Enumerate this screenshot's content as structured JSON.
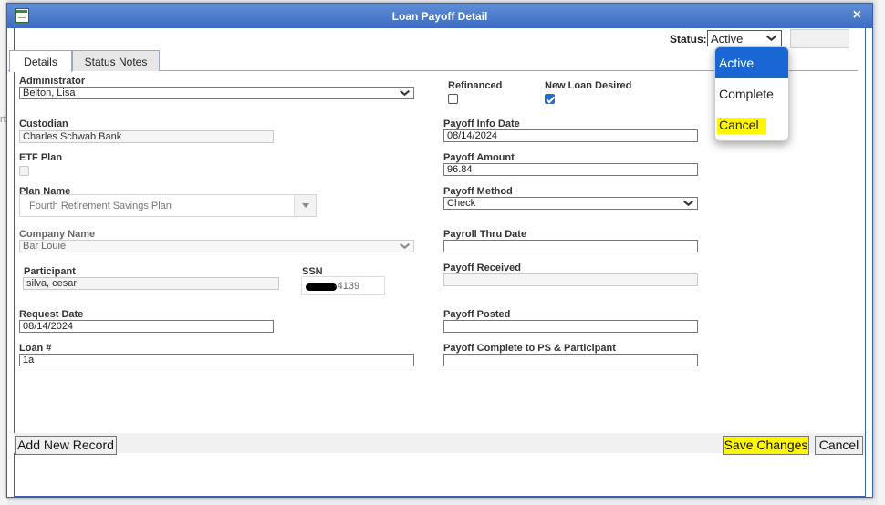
{
  "dialog": {
    "title": "Loan Payoff Detail",
    "close": "×"
  },
  "background": {
    "left_text": "rth"
  },
  "status": {
    "label": "Status:",
    "value": "Active",
    "options": [
      "Active",
      "Complete",
      "Cancel"
    ]
  },
  "tabs": [
    {
      "label": "Details",
      "active": true
    },
    {
      "label": "Status Notes",
      "active": false
    }
  ],
  "left": {
    "administrator": {
      "label": "Administrator",
      "value": "Belton, Lisa"
    },
    "custodian": {
      "label": "Custodian",
      "value": "Charles Schwab Bank"
    },
    "etf_plan": {
      "label": "ETF Plan",
      "checked": false
    },
    "plan_name": {
      "label": "Plan Name",
      "value": "Fourth Retirement Savings Plan"
    },
    "company_name": {
      "label": "Company Name",
      "value": "Bar Louie"
    },
    "participant": {
      "label": "Participant",
      "value": "silva, cesar"
    },
    "ssn": {
      "label": "SSN",
      "value": "-4139"
    },
    "request_date": {
      "label": "Request Date",
      "value": "08/14/2024"
    },
    "loan_no": {
      "label": "Loan #",
      "value": "1a"
    }
  },
  "right": {
    "refinanced": {
      "label": "Refinanced",
      "checked": false
    },
    "new_loan_desired": {
      "label": "New Loan Desired",
      "checked": true
    },
    "payoff_info_date": {
      "label": "Payoff Info Date",
      "value": "08/14/2024"
    },
    "payoff_amount": {
      "label": "Payoff Amount",
      "value": "96.84"
    },
    "payoff_method": {
      "label": "Payoff Method",
      "value": "Check"
    },
    "payroll_thru_date": {
      "label": "Payroll Thru Date",
      "value": ""
    },
    "payoff_received": {
      "label": "Payoff Received",
      "value": ""
    },
    "payoff_posted": {
      "label": "Payoff Posted",
      "value": ""
    },
    "payoff_complete": {
      "label": "Payoff Complete to PS & Participant",
      "value": ""
    }
  },
  "buttons": {
    "add_new": "Add New Record",
    "save": "Save Changes",
    "cancel": "Cancel"
  },
  "colors": {
    "titlebar": "#3c6bc0",
    "selected_option": "#1967d2",
    "highlight": "#fff700"
  }
}
